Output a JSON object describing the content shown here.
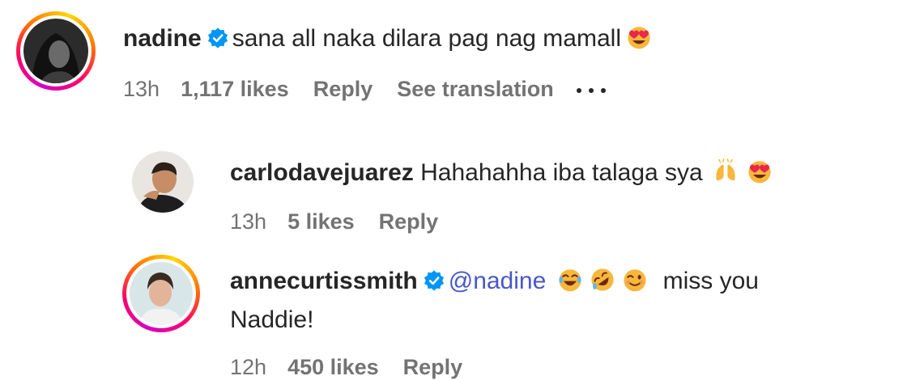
{
  "comments": [
    {
      "username": "nadine",
      "verified": true,
      "text": "sana all naka dilara pag nag mamall",
      "emojis": [
        "heart-eyes"
      ],
      "time": "13h",
      "likes": "1,117 likes",
      "reply_label": "Reply",
      "translation_label": "See translation",
      "more_label": "•••"
    },
    {
      "username": "carlodavejuarez",
      "verified": false,
      "text": "Hahahahha iba talaga sya",
      "emojis": [
        "raising-hands",
        "heart-eyes"
      ],
      "time": "13h",
      "likes": "5 likes",
      "reply_label": "Reply"
    },
    {
      "username": "annecurtissmith",
      "verified": true,
      "mention": "@nadine",
      "emojis": [
        "joy",
        "rofl",
        "wink"
      ],
      "text_line1": "miss you",
      "text_line2": "Naddie!",
      "time": "12h",
      "likes": "450 likes",
      "reply_label": "Reply"
    }
  ],
  "colors": {
    "verified_blue": "#0095f6",
    "mention": "#4758c8",
    "meta_gray": "#737373"
  }
}
